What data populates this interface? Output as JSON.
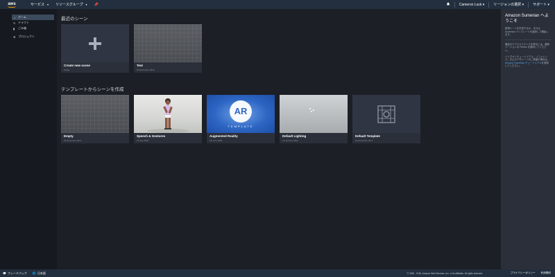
{
  "topnav": {
    "logo": "aws",
    "services": "サービス",
    "resource_groups": "リソースグループ",
    "bell_icon": "bell-icon",
    "user": "Cameron Luck",
    "region": "リージョンの選択",
    "support": "サポート"
  },
  "sidebar": {
    "items": [
      {
        "label": "ホーム",
        "icon": "home-icon"
      },
      {
        "label": "ドラフト",
        "icon": "pencil-icon"
      },
      {
        "label": "ごみ箱",
        "icon": "trash-icon"
      },
      {
        "label": "プロジェクト",
        "icon": "gear-icon"
      }
    ]
  },
  "main": {
    "recent_title": "最近のシーン",
    "recent": [
      {
        "title": "Create new scene",
        "date": "Today"
      },
      {
        "title": "Test",
        "date": "15 November 2018"
      }
    ],
    "templates_title": "テンプレートからシーンを作成",
    "templates": [
      {
        "title": "Empty",
        "date": "23 November 2017"
      },
      {
        "title": "Speech & Gestures",
        "date": "16 July 2018"
      },
      {
        "title": "Augmented Reality",
        "date": "06 June 2018"
      },
      {
        "title": "Default Lighting",
        "date": "12 January 2018"
      },
      {
        "title": "Default Template",
        "date": "22 November 2017"
      }
    ],
    "ar_logo": "AR",
    "ar_sub": "TEMPLATE"
  },
  "rightpanel": {
    "title": "Amazon Sumerian へようこそ",
    "p1": "新規シーンを作成するか、または Sumerian テンプレートを選択して開始します。",
    "p2": "最高のエクスペリエンスを得るには、最新バージョンの Firefox を使用してください。",
    "p3_pre": "ハンズオンチュートリアル、リファレンス、およびデモシーンのご希望の場合は、",
    "p3_link": "Amazon Sumerian チュートリアル",
    "p3_post": "を参照してください。"
  },
  "footer": {
    "feedback": "フィードバック",
    "language": "日本語",
    "copyright": "© 2008 - 2018, Amazon Web Services, Inc. or its affiliates. All rights reserved.",
    "privacy": "プライバシーポリシー",
    "terms": "利用規約"
  },
  "colors": {
    "background": "#1c1f26",
    "nav": "#232f3e",
    "card": "#2a2f3a",
    "accent": "#f90"
  }
}
